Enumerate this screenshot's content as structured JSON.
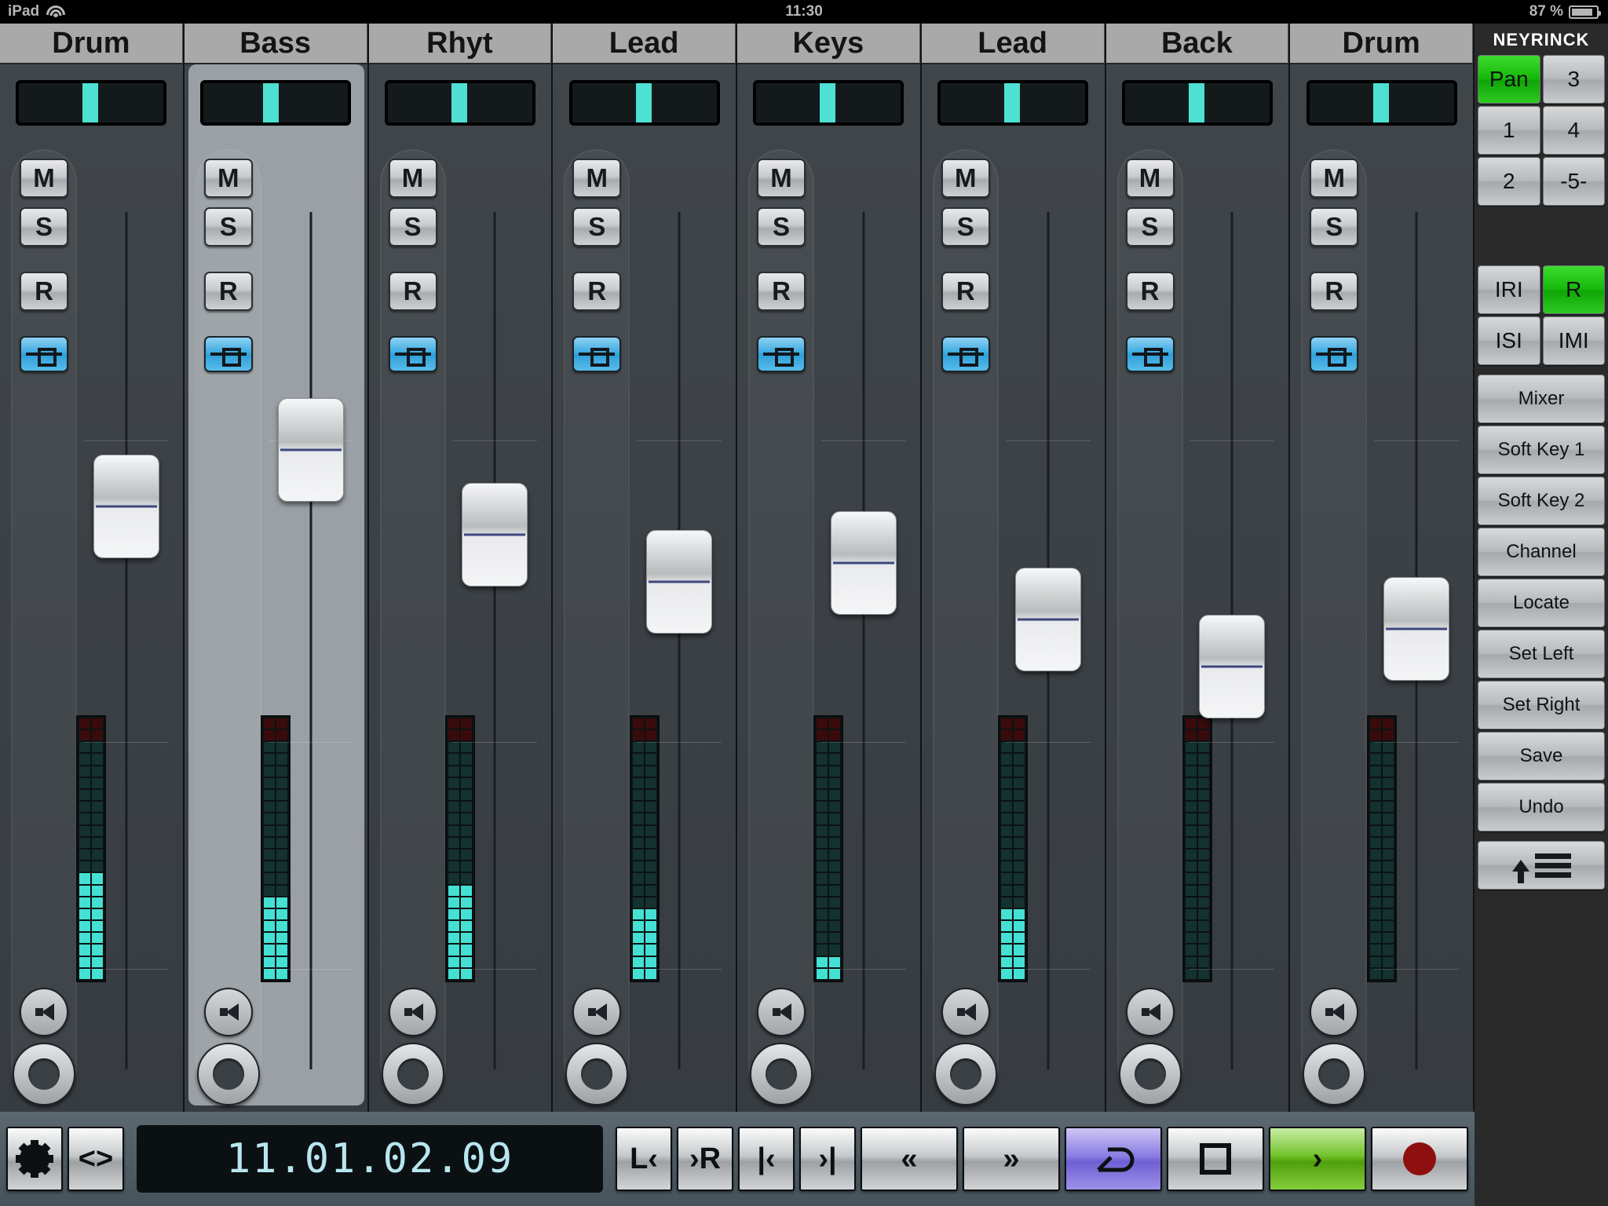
{
  "status_bar": {
    "device_label": "iPad",
    "wifi_icon": "wifi-icon",
    "time": "11:30",
    "battery_percent": "87 %",
    "battery_icon": "battery-icon"
  },
  "mixer": {
    "channels": [
      {
        "name": "Drum",
        "selected": false,
        "pan_pct": 44,
        "mute": "M",
        "solo": "S",
        "rec": "R",
        "io_icon": "insert-icon",
        "meter": {
          "segments": 22,
          "lit": 9,
          "red_segments": 2,
          "red_lit": 0
        },
        "fader_pos_pct": 37
      },
      {
        "name": "Bass",
        "selected": true,
        "pan_pct": 41,
        "mute": "M",
        "solo": "S",
        "rec": "R",
        "io_icon": "insert-icon",
        "meter": {
          "segments": 22,
          "lit": 7,
          "red_segments": 2,
          "red_lit": 0
        },
        "fader_pos_pct": 31
      },
      {
        "name": "Rhyt",
        "selected": false,
        "pan_pct": 44,
        "mute": "M",
        "solo": "S",
        "rec": "R",
        "io_icon": "insert-icon",
        "meter": {
          "segments": 22,
          "lit": 8,
          "red_segments": 2,
          "red_lit": 0
        },
        "fader_pos_pct": 40
      },
      {
        "name": "Lead",
        "selected": false,
        "pan_pct": 44,
        "mute": "M",
        "solo": "S",
        "rec": "R",
        "io_icon": "insert-icon",
        "meter": {
          "segments": 22,
          "lit": 6,
          "red_segments": 2,
          "red_lit": 0
        },
        "fader_pos_pct": 45
      },
      {
        "name": "Keys",
        "selected": false,
        "pan_pct": 44,
        "mute": "M",
        "solo": "S",
        "rec": "R",
        "io_icon": "insert-icon",
        "meter": {
          "segments": 22,
          "lit": 2,
          "red_segments": 2,
          "red_lit": 0
        },
        "fader_pos_pct": 43
      },
      {
        "name": "Lead",
        "selected": false,
        "pan_pct": 44,
        "mute": "M",
        "solo": "S",
        "rec": "R",
        "io_icon": "insert-icon",
        "meter": {
          "segments": 22,
          "lit": 6,
          "red_segments": 2,
          "red_lit": 0
        },
        "fader_pos_pct": 49
      },
      {
        "name": "Back",
        "selected": false,
        "pan_pct": 44,
        "mute": "M",
        "solo": "S",
        "rec": "R",
        "io_icon": "insert-icon",
        "meter": {
          "segments": 22,
          "lit": 0,
          "red_segments": 2,
          "red_lit": 0
        },
        "fader_pos_pct": 54
      },
      {
        "name": "Drum",
        "selected": false,
        "pan_pct": 44,
        "mute": "M",
        "solo": "S",
        "rec": "R",
        "io_icon": "insert-icon",
        "meter": {
          "segments": 22,
          "lit": 0,
          "red_segments": 2,
          "red_lit": 0
        },
        "fader_pos_pct": 50
      }
    ]
  },
  "sidebar": {
    "brand": "NEYRINCK",
    "pads": [
      {
        "label": "Pan",
        "active": true
      },
      {
        "label": "3",
        "active": false
      },
      {
        "label": "1",
        "active": false
      },
      {
        "label": "4",
        "active": false
      },
      {
        "label": "2",
        "active": false
      },
      {
        "label": "-5-",
        "active": false
      }
    ],
    "mode_pads": [
      {
        "label": "IRI",
        "active": false
      },
      {
        "label": "R",
        "active": true
      },
      {
        "label": "ISI",
        "active": false
      },
      {
        "label": "IMI",
        "active": false
      }
    ],
    "buttons": [
      {
        "label": "Mixer"
      },
      {
        "label": "Soft Key 1"
      },
      {
        "label": "Soft Key 2"
      },
      {
        "label": "Channel"
      },
      {
        "label": "Locate"
      },
      {
        "label": "Set Left"
      },
      {
        "label": "Set Right"
      },
      {
        "label": "Save"
      },
      {
        "label": "Undo"
      }
    ],
    "list_button_icon": "upload-list-icon"
  },
  "transport": {
    "settings_icon": "gear-icon",
    "expand_label": "<>",
    "timecode": "11.01.02.09",
    "buttons": [
      {
        "name": "mark-left",
        "label": "L‹",
        "style": "plain"
      },
      {
        "name": "mark-right",
        "label": "›R",
        "style": "plain"
      },
      {
        "name": "go-to-start",
        "label": "|‹",
        "style": "plain"
      },
      {
        "name": "go-to-end",
        "label": "›|",
        "style": "plain"
      },
      {
        "name": "rewind",
        "label": "«",
        "style": "wide"
      },
      {
        "name": "fast-forward",
        "label": "»",
        "style": "wide"
      },
      {
        "name": "loop",
        "label": "loop-icon",
        "style": "purple"
      },
      {
        "name": "stop",
        "label": "stop-icon",
        "style": "plain-wide"
      },
      {
        "name": "play",
        "label": "›",
        "style": "green"
      },
      {
        "name": "record",
        "label": "record-icon",
        "style": "plain-wide"
      }
    ]
  },
  "colors": {
    "accent_cyan": "#45e0d4",
    "accent_blue": "#35a7e0",
    "accent_green": "#14b80a",
    "accent_purple": "#6f5fd4",
    "record_red": "#8e0f0f",
    "timecode_text": "#b7e6ef"
  }
}
